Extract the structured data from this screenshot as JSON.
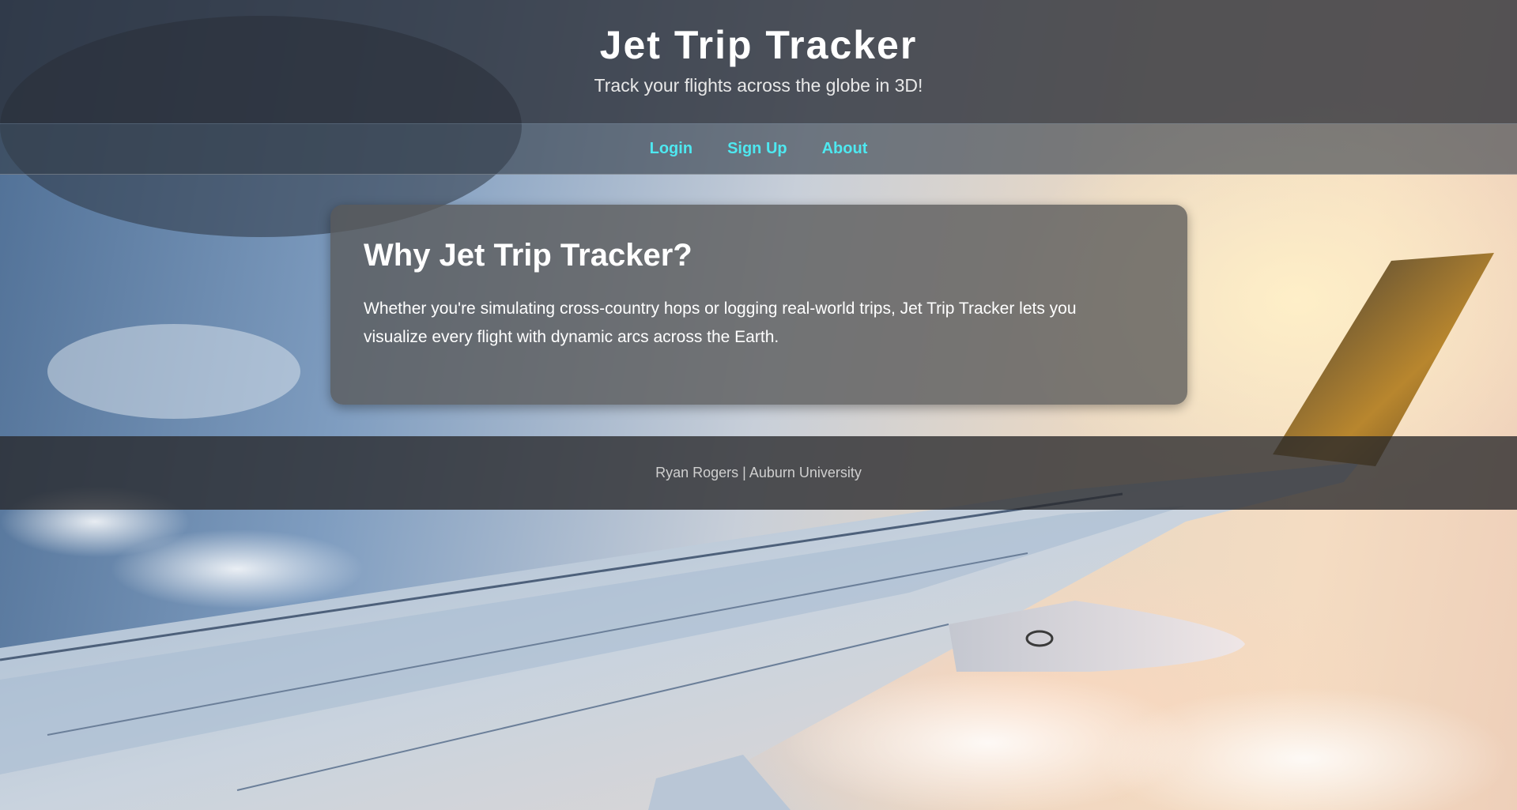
{
  "header": {
    "title": "Jet Trip Tracker",
    "subtitle": "Track your flights across the globe in 3D!"
  },
  "nav": {
    "items": [
      {
        "label": "Login"
      },
      {
        "label": "Sign Up"
      },
      {
        "label": "About"
      }
    ],
    "link_color": "#4ee8f0"
  },
  "main": {
    "card": {
      "heading": "Why Jet Trip Tracker?",
      "body": "Whether you're simulating cross-country hops or logging real-world trips, Jet Trip Tracker lets you visualize every flight with dynamic arcs across the Earth."
    }
  },
  "footer": {
    "text": "Ryan Rogers | Auburn University"
  }
}
